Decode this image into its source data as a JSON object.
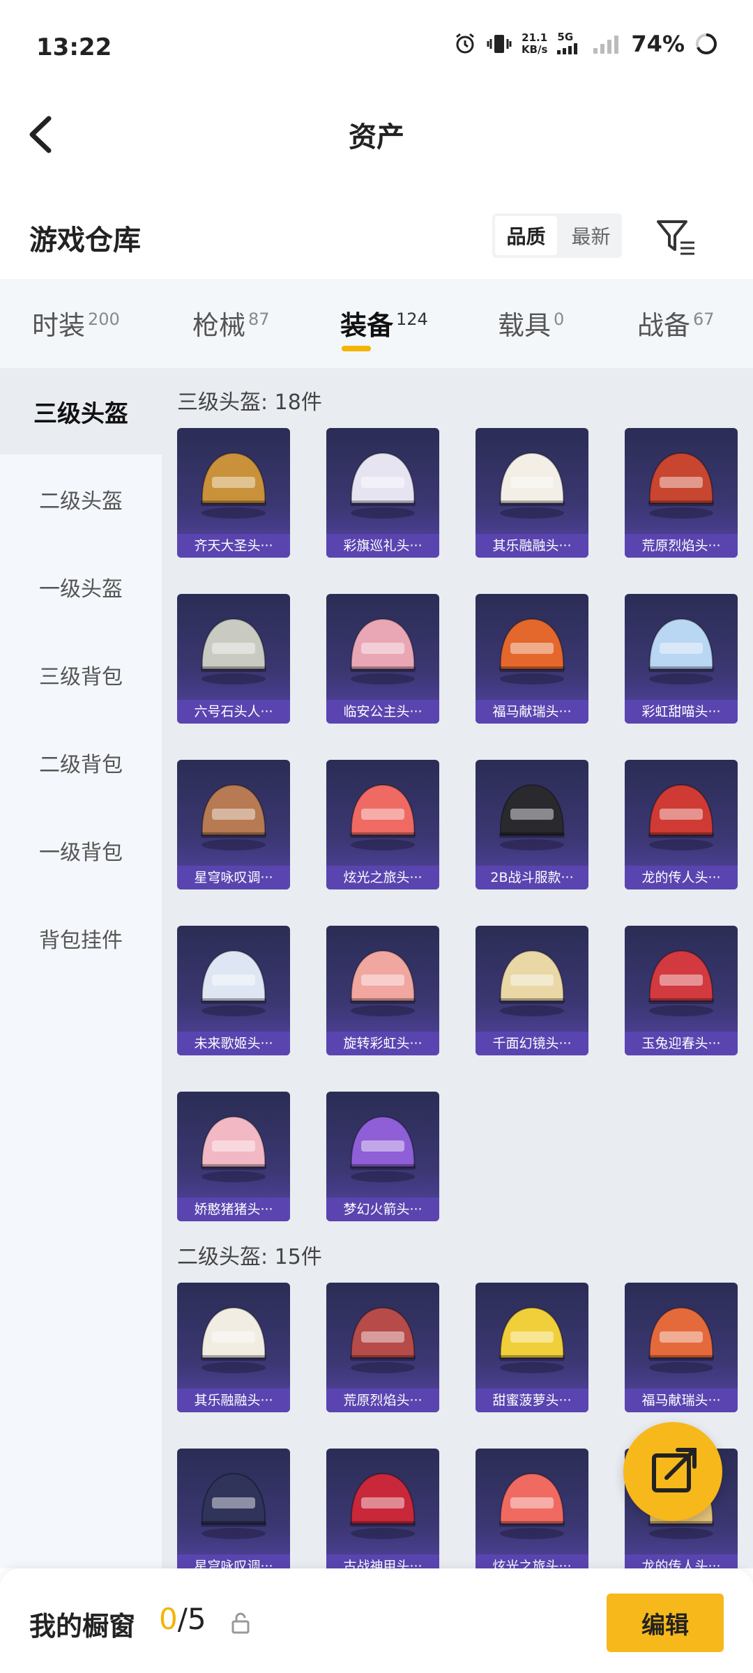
{
  "status_bar": {
    "time": "13:22",
    "speed_value": "21.1",
    "speed_unit": "KB/s",
    "network": "5G",
    "battery": "74%"
  },
  "nav": {
    "title": "资产"
  },
  "header": {
    "section_title": "游戏仓库",
    "sort_options": [
      "品质",
      "最新"
    ],
    "active_sort": "品质"
  },
  "tabs": [
    {
      "label": "时装",
      "count": "200"
    },
    {
      "label": "枪械",
      "count": "87"
    },
    {
      "label": "装备",
      "count": "124"
    },
    {
      "label": "载具",
      "count": "0"
    },
    {
      "label": "战备",
      "count": "67"
    }
  ],
  "active_tab": "装备",
  "sidebar": {
    "items": [
      "三级头盔",
      "二级头盔",
      "一级头盔",
      "三级背包",
      "二级背包",
      "一级背包",
      "背包挂件"
    ],
    "active": "三级头盔"
  },
  "groups": [
    {
      "title": "三级头盔: 18件",
      "items": [
        {
          "name": "齐天大圣头···",
          "color": "#c9923a"
        },
        {
          "name": "彩旗巡礼头···",
          "color": "#e7e4f2"
        },
        {
          "name": "其乐融融头···",
          "color": "#f3efe6"
        },
        {
          "name": "荒原烈焰头···",
          "color": "#c8452f"
        },
        {
          "name": "六号石头人···",
          "color": "#c9cbc2"
        },
        {
          "name": "临安公主头···",
          "color": "#e9a7b5"
        },
        {
          "name": "福马献瑞头···",
          "color": "#e4672c"
        },
        {
          "name": "彩虹甜喵头···",
          "color": "#b9d6f2"
        },
        {
          "name": "星穹咏叹调···",
          "color": "#b77a52"
        },
        {
          "name": "炫光之旅头···",
          "color": "#ef6a63"
        },
        {
          "name": "2B战斗服款···",
          "color": "#2a2a2e"
        },
        {
          "name": "龙的传人头···",
          "color": "#cf3b34"
        },
        {
          "name": "未来歌姬头···",
          "color": "#dfe6f3"
        },
        {
          "name": "旋转彩虹头···",
          "color": "#f1a6a0"
        },
        {
          "name": "千面幻镜头···",
          "color": "#e9d7a6"
        },
        {
          "name": "玉兔迎春头···",
          "color": "#d23a3f"
        },
        {
          "name": "娇憨猪猪头···",
          "color": "#f2b8c4"
        },
        {
          "name": "梦幻火箭头···",
          "color": "#8e5fd6"
        }
      ]
    },
    {
      "title": "二级头盔: 15件",
      "items": [
        {
          "name": "其乐融融头···",
          "color": "#f1ede3"
        },
        {
          "name": "荒原烈焰头···",
          "color": "#b64b49"
        },
        {
          "name": "甜蜜菠萝头···",
          "color": "#f1cf3a"
        },
        {
          "name": "福马献瑞头···",
          "color": "#e46a3c"
        },
        {
          "name": "星穹咏叹调···",
          "color": "#30345a"
        },
        {
          "name": "古战神甲头···",
          "color": "#c8283a"
        },
        {
          "name": "炫光之旅头···",
          "color": "#f06a62"
        },
        {
          "name": "龙的传人头···",
          "color": "#e6c27a"
        }
      ]
    }
  ],
  "bottom": {
    "window_label": "我的橱窗",
    "count_current": "0",
    "count_max": "/5",
    "edit_label": "编辑"
  }
}
